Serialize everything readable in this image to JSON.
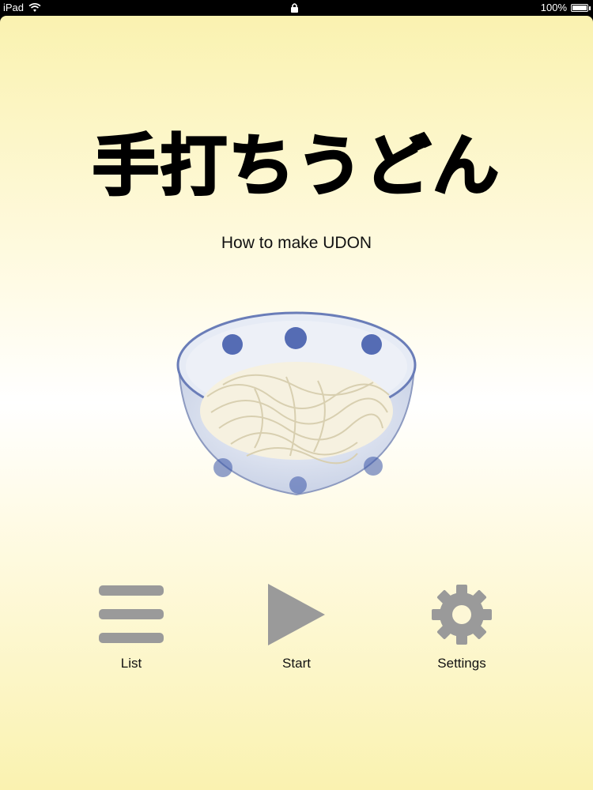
{
  "status_bar": {
    "device": "iPad",
    "battery_percent": "100%",
    "battery_level": 1.0
  },
  "main": {
    "title": "手打ちうどん",
    "subtitle": "How to make UDON"
  },
  "actions": {
    "list_label": "List",
    "start_label": "Start",
    "settings_label": "Settings"
  },
  "colors": {
    "background_yellow": "#faf2b0",
    "icon_gray": "#9a9a9a",
    "bowl_blue": "#3a55a8",
    "noodle": "#f6f1e0"
  },
  "icons": {
    "list": "list-icon",
    "start": "play-icon",
    "settings": "gear-icon"
  }
}
